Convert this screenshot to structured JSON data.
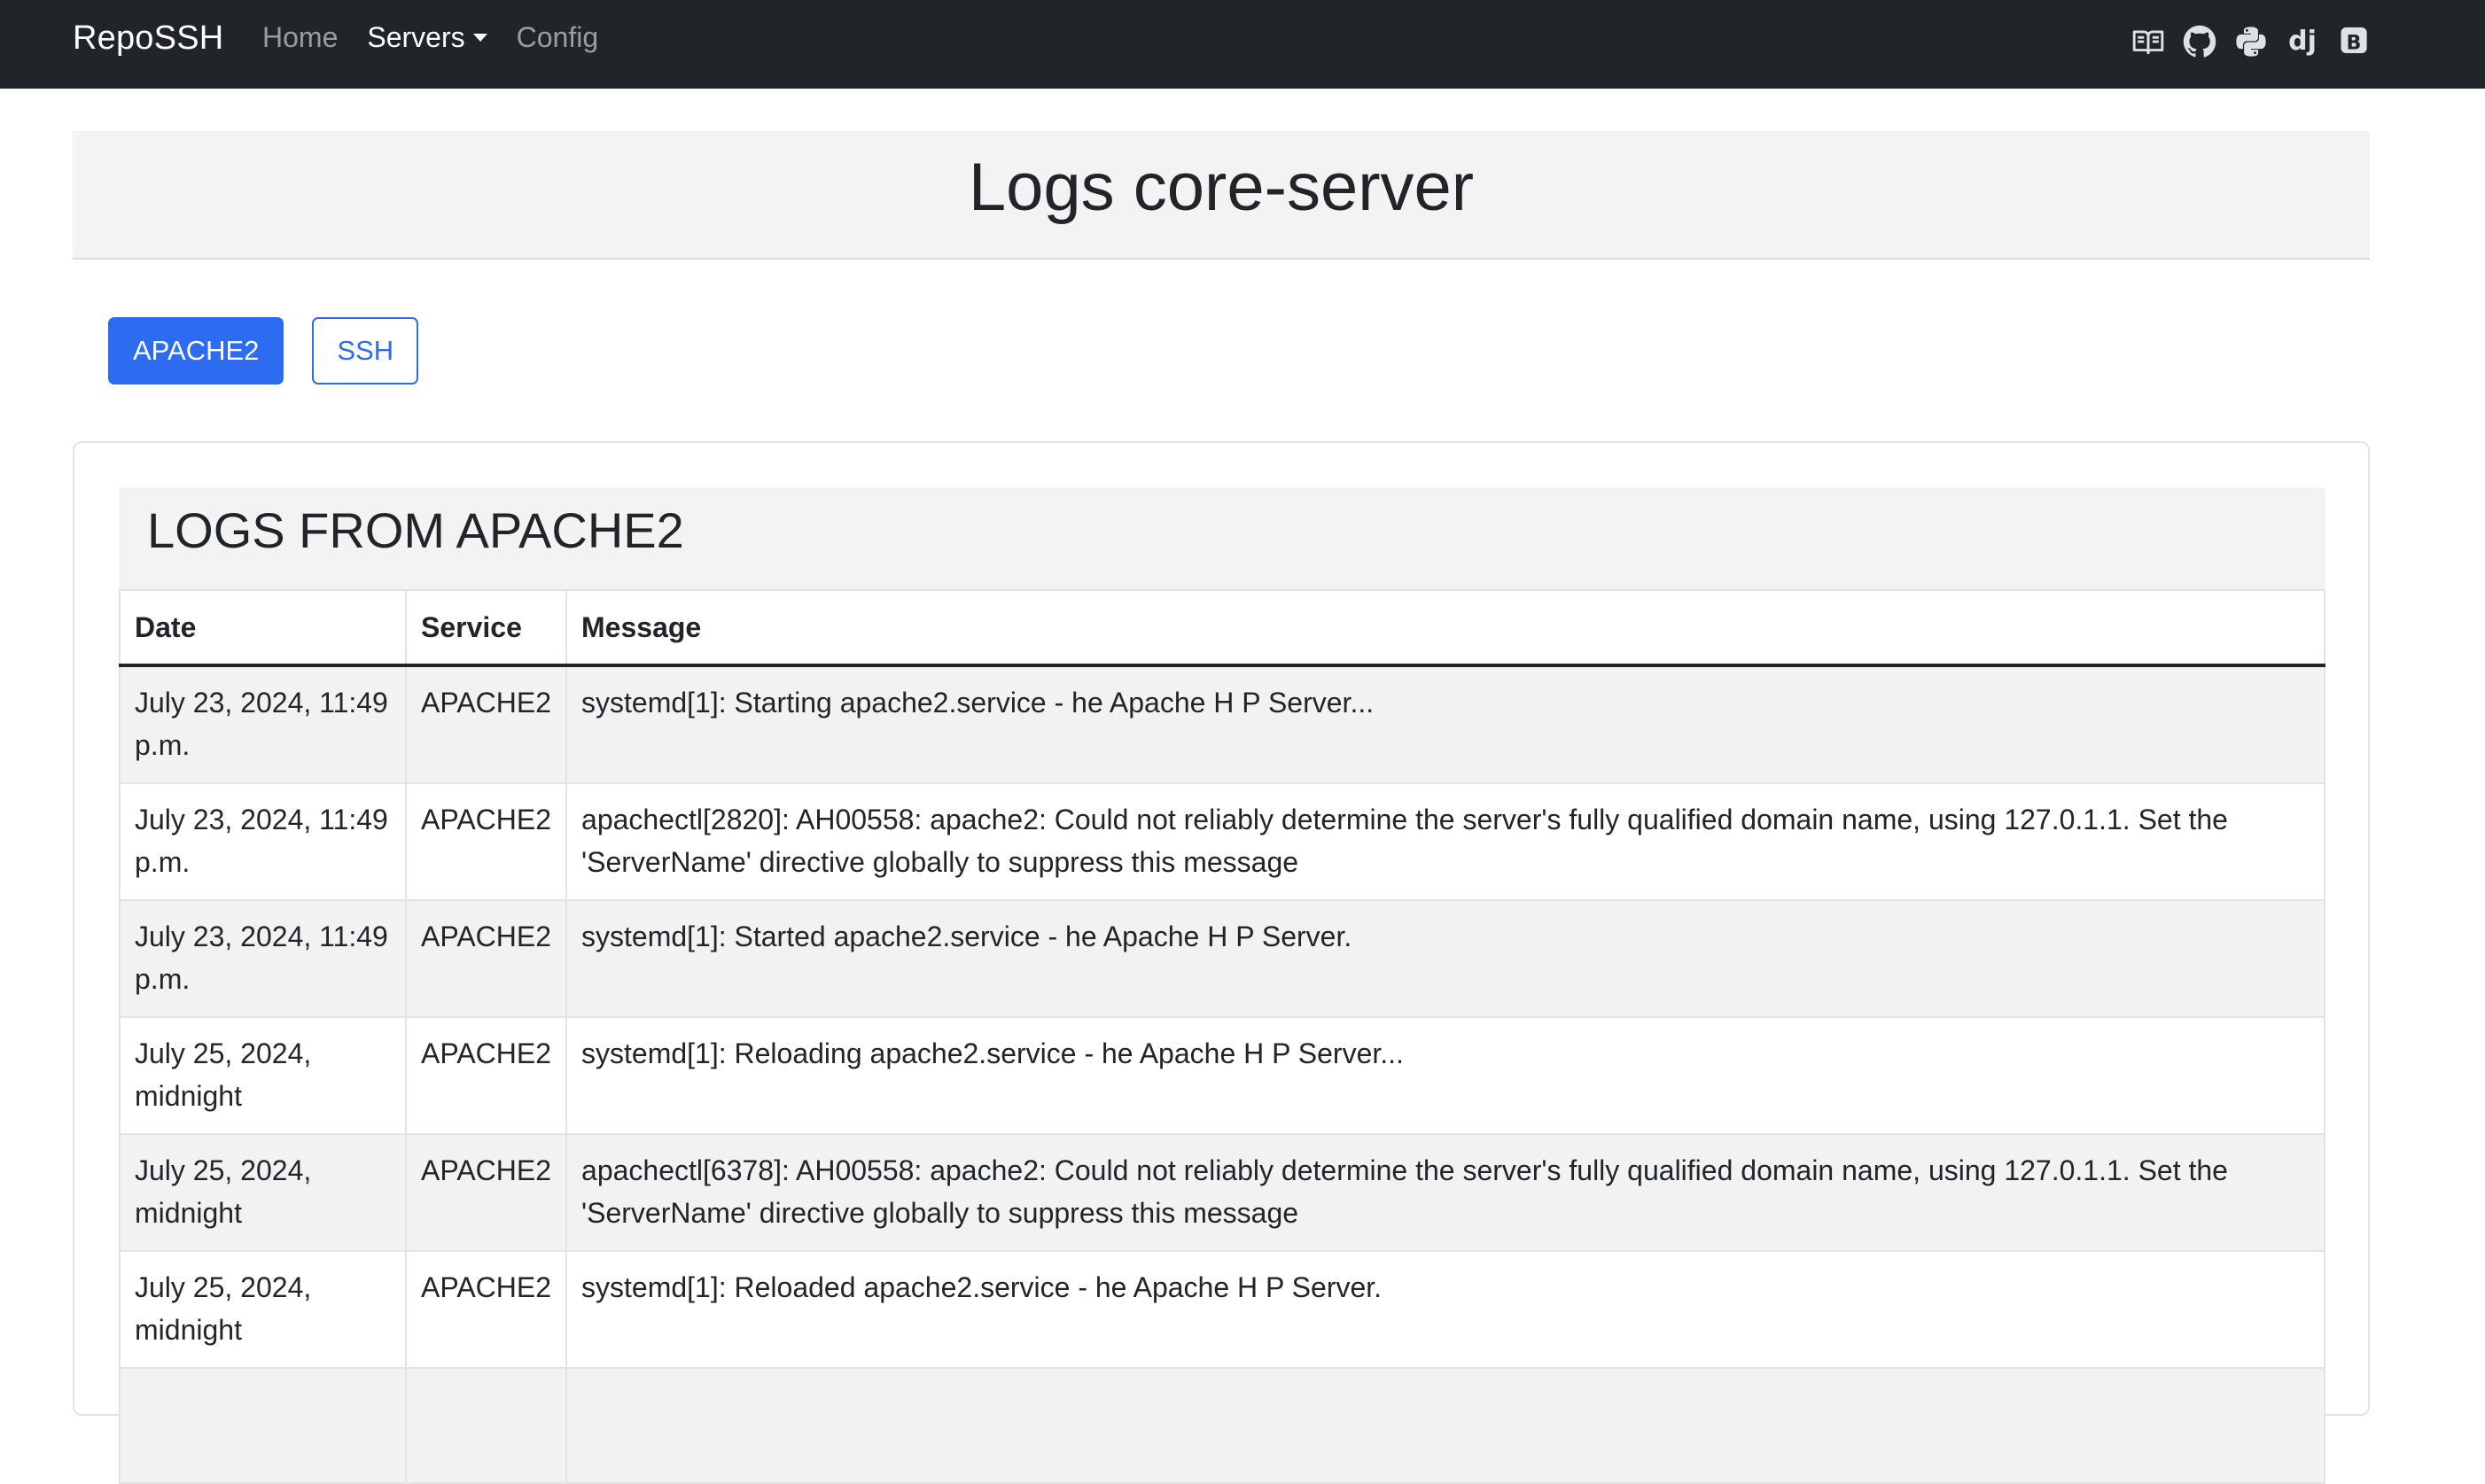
{
  "navbar": {
    "brand": "RepoSSH",
    "links": [
      {
        "label": "Home",
        "active": false
      },
      {
        "label": "Servers",
        "active": true,
        "dropdown": true
      },
      {
        "label": "Config",
        "active": false
      }
    ],
    "icons": [
      "book-icon",
      "github-icon",
      "python-icon",
      "django-icon",
      "bootstrap-icon"
    ],
    "django_text": "dj",
    "bootstrap_text": "B"
  },
  "page": {
    "title": "Logs core-server"
  },
  "buttons": {
    "apache": "APACHE2",
    "ssh": "SSH"
  },
  "logs": {
    "title": "LOGS FROM APACHE2",
    "columns": [
      "Date",
      "Service",
      "Message"
    ],
    "rows": [
      {
        "date": "July 23, 2024, 11:49 p.m.",
        "service": "APACHE2",
        "message": "systemd[1]: Starting apache2.service - he Apache H P Server..."
      },
      {
        "date": "July 23, 2024, 11:49 p.m.",
        "service": "APACHE2",
        "message": "apachectl[2820]: AH00558: apache2: Could not reliably determine the server's fully qualified domain name, using 127.0.1.1. Set the 'ServerName' directive globally to suppress this message"
      },
      {
        "date": "July 23, 2024, 11:49 p.m.",
        "service": "APACHE2",
        "message": "systemd[1]: Started apache2.service - he Apache H P Server."
      },
      {
        "date": "July 25, 2024, midnight",
        "service": "APACHE2",
        "message": "systemd[1]: Reloading apache2.service - he Apache H P Server..."
      },
      {
        "date": "July 25, 2024, midnight",
        "service": "APACHE2",
        "message": "apachectl[6378]: AH00558: apache2: Could not reliably determine the server's fully qualified domain name, using 127.0.1.1. Set the 'ServerName' directive globally to suppress this message"
      },
      {
        "date": "July 25, 2024, midnight",
        "service": "APACHE2",
        "message": "systemd[1]: Reloaded apache2.service - he Apache H P Server."
      },
      {
        "date": "",
        "service": "",
        "message": ""
      }
    ]
  },
  "colors": {
    "navbar_bg": "#212529",
    "primary": "#2d6cf0",
    "stripe": "#f2f2f2"
  }
}
